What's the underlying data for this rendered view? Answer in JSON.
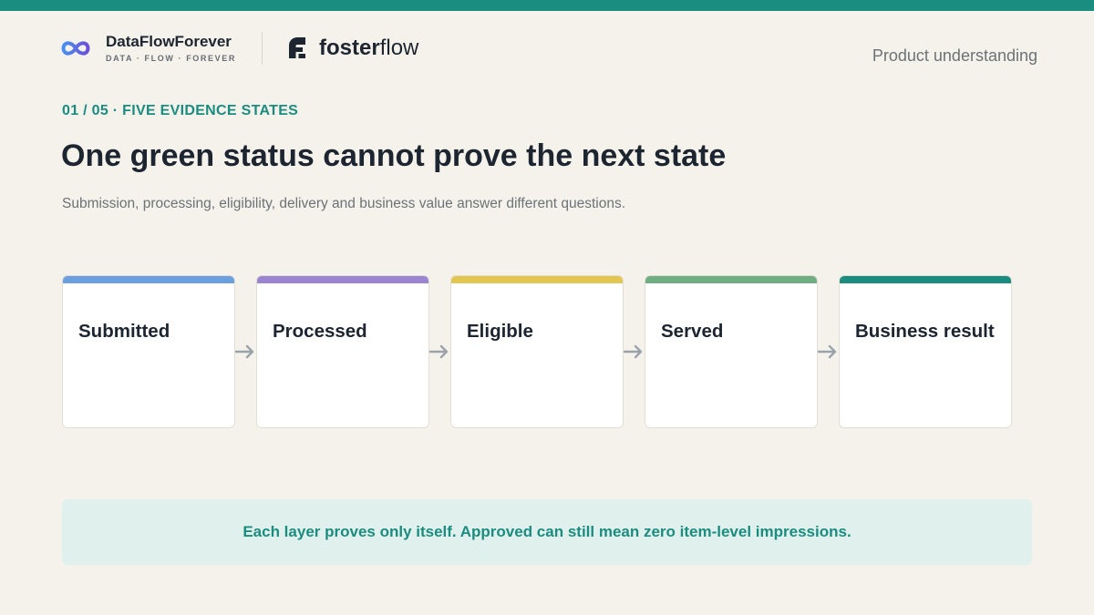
{
  "colors": {
    "accent": "#1b8c80",
    "background": "#f5f2eb",
    "stage_submitted": "#6b9fe0",
    "stage_processed": "#9b85d0",
    "stage_eligible": "#e3c552",
    "stage_served": "#70ad82",
    "stage_business_result": "#1b8c80"
  },
  "brand": {
    "name": "DataFlowForever",
    "tagline": "DATA · FLOW · FOREVER",
    "logo_icon": "infinity-icon"
  },
  "partner": {
    "name_bold": "foster",
    "name_light": "flow",
    "logo_icon": "fosterflow-leaf-icon"
  },
  "header": {
    "section": "Product understanding"
  },
  "slide": {
    "kicker": "01 / 05 · FIVE EVIDENCE STATES",
    "title": "One green status cannot prove the next state",
    "subtitle": "Submission, processing, eligibility, delivery and business value answer different questions."
  },
  "stages": [
    {
      "label": "Submitted",
      "color": "#6b9fe0"
    },
    {
      "label": "Processed",
      "color": "#9b85d0"
    },
    {
      "label": "Eligible",
      "color": "#e3c552"
    },
    {
      "label": "Served",
      "color": "#70ad82"
    },
    {
      "label": "Business result",
      "color": "#1b8c80"
    }
  ],
  "callout": {
    "text": "Each layer proves only itself. Approved can still mean zero item-level impressions."
  }
}
